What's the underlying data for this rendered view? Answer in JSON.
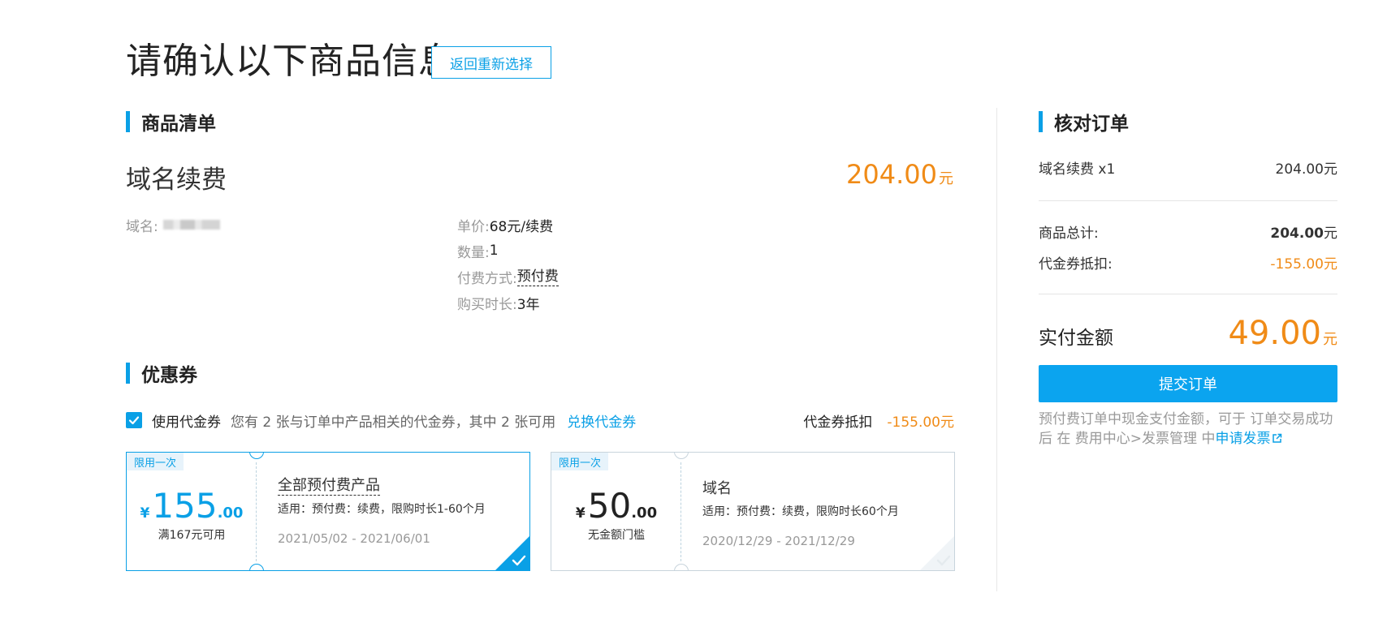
{
  "header": {
    "title": "请确认以下商品信息",
    "back_button": "返回重新选择"
  },
  "product_section": {
    "heading": "商品清单",
    "name": "域名续费",
    "price": "204.00",
    "price_unit": "元",
    "domain_label": "域名:",
    "details": [
      {
        "label": "单价:",
        "value": "68元/续费"
      },
      {
        "label": "数量:",
        "value": "1"
      },
      {
        "label": "付费方式:",
        "value": "预付费"
      },
      {
        "label": "购买时长:",
        "value": "3年"
      }
    ]
  },
  "coupon_section": {
    "heading": "优惠券",
    "use_checked": true,
    "use_label": "使用代金券",
    "description": "您有 2 张与订单中产品相关的代金券，其中 2 张可用",
    "exchange_link": "兑换代金券",
    "deduction_label": "代金券抵扣",
    "deduction_value": "-155.00元",
    "coupons": [
      {
        "tag": "限用一次",
        "currency": "¥",
        "amount_int": "155",
        "amount_dec": ".00",
        "condition": "满167元可用",
        "scope": "全部预付费产品",
        "applies": "适用：预付费：续费，限购时长1-60个月",
        "dates": "2021/05/02 - 2021/06/01",
        "selected": true
      },
      {
        "tag": "限用一次",
        "currency": "¥",
        "amount_int": "50",
        "amount_dec": ".00",
        "condition": "无金额门槛",
        "scope": "域名",
        "applies": "适用：预付费：续费，限购时长60个月",
        "dates": "2020/12/29 - 2021/12/29",
        "selected": false
      }
    ]
  },
  "order_summary": {
    "heading": "核对订单",
    "item_label": "域名续费 x1",
    "item_value": "204.00元",
    "total_label": "商品总计:",
    "total_value": "204.00",
    "total_unit": "元",
    "coupon_label": "代金券抵扣:",
    "coupon_value": "-155.00元",
    "pay_label": "实付金额",
    "pay_value": "49.00",
    "pay_unit": "元",
    "submit_button": "提交订单",
    "note_text": "预付费订单中现金支付金额，可于 订单交易成功后 在 费用中心>发票管理 中",
    "invoice_link": "申请发票"
  },
  "colors": {
    "accent": "#0aa0e6",
    "price": "#f08b17",
    "button": "#0ba4ef"
  },
  "icons": [
    "check-icon",
    "external-link-icon",
    "selected-corner-icon"
  ]
}
